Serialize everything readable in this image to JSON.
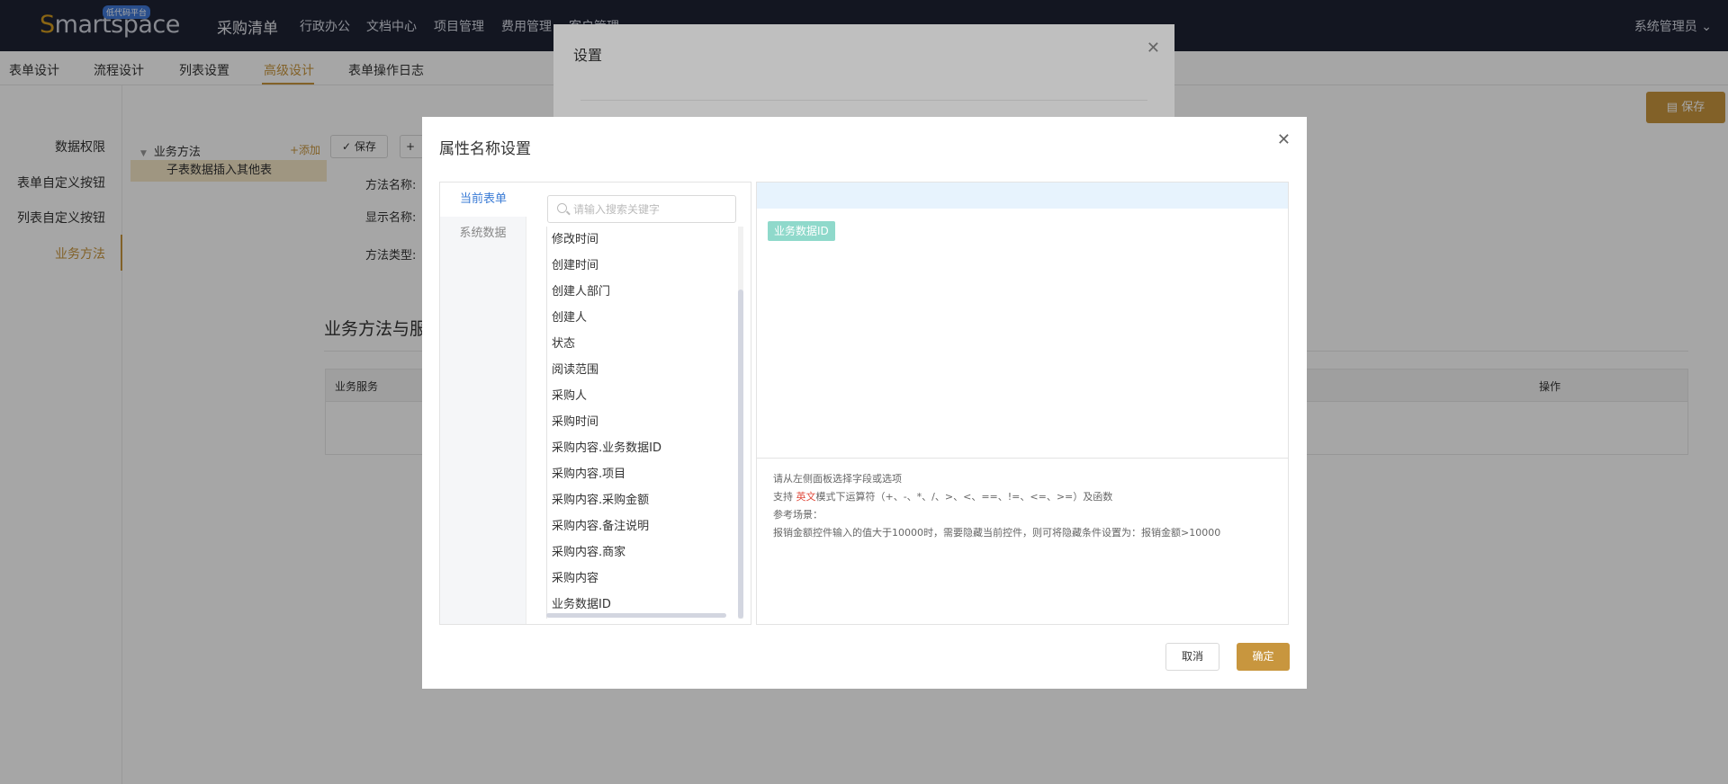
{
  "topnav": {
    "logo_first": "S",
    "logo_rest": "martspace",
    "logo_badge": "低代码平台",
    "app_title": "采购清单",
    "items": [
      "行政办公",
      "文档中心",
      "项目管理",
      "费用管理",
      "客户管理"
    ],
    "user": "系统管理员"
  },
  "subtabs": {
    "items": [
      "表单设计",
      "流程设计",
      "列表设置",
      "高级设计",
      "表单操作日志"
    ],
    "active": "高级设计"
  },
  "left_menu": {
    "items": [
      "数据权限",
      "表单自定义按钮",
      "列表自定义按钮",
      "业务方法"
    ],
    "active": "业务方法"
  },
  "tree": {
    "root": "业务方法",
    "add": "+添加",
    "child": "子表数据插入其他表"
  },
  "form": {
    "save_btn": "保存",
    "method_name_label": "方法名称:",
    "display_name_label": "显示名称:",
    "method_type_label": "方法类型:",
    "section_title": "业务方法与服",
    "table_headers": [
      "业务服务",
      "操作"
    ]
  },
  "page_save": "保存",
  "dialog_settings": {
    "title": "设置"
  },
  "dialog": {
    "title": "属性名称设置",
    "source_tabs": [
      "当前表单",
      "系统数据"
    ],
    "active_tab": "当前表单",
    "search_placeholder": "请输入搜索关键字",
    "fields": [
      "修改时间",
      "创建时间",
      "创建人部门",
      "创建人",
      "状态",
      "阅读范围",
      "采购人",
      "采购时间",
      "采购内容.业务数据ID",
      "采购内容.项目",
      "采购内容.采购金额",
      "采购内容.备注说明",
      "采购内容.商家",
      "采购内容",
      "业务数据ID"
    ],
    "selected_token": "业务数据ID",
    "hints": {
      "line1": "请从左侧面板选择字段或选项",
      "line2_pre": "支持",
      "line2_red": "英文",
      "line2_post": "模式下运算符（+、-、*、/、>、<、==、!=、<=、>=）及函数",
      "line3": "参考场景：",
      "line4": "报销金额控件输入的值大于10000时，需要隐藏当前控件，则可将隐藏条件设置为：报销金额>10000"
    },
    "cancel": "取消",
    "ok": "确定"
  }
}
